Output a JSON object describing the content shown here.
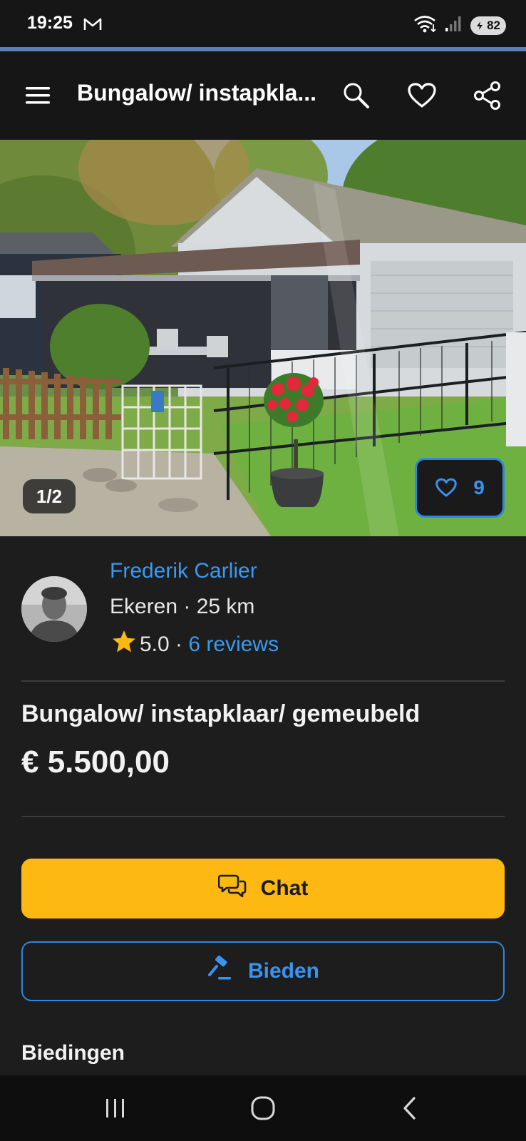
{
  "status_bar": {
    "time": "19:25",
    "battery": "82"
  },
  "app_bar": {
    "title": "Bungalow/ instapkla..."
  },
  "photo": {
    "counter": "1/2",
    "favorites_count": "9"
  },
  "seller": {
    "name": "Frederik Carlier",
    "location": "Ekeren · 25 km",
    "rating": "5.0",
    "separator": " · ",
    "reviews": "6 reviews"
  },
  "listing": {
    "title": "Bungalow/ instapklaar/ gemeubeld",
    "price": "€ 5.500,00"
  },
  "actions": {
    "chat_label": "Chat",
    "bid_label": "Bieden"
  },
  "sections": {
    "bids_title": "Biedingen"
  },
  "colors": {
    "accent_blue": "#3a9af0",
    "chat_yellow": "#fdb812",
    "star": "#fdb812",
    "background": "#1d1d1d"
  },
  "icons": [
    "mail-icon",
    "wifi-icon",
    "signal-icon",
    "battery-icon",
    "menu-icon",
    "search-icon",
    "heart-icon",
    "share-icon",
    "star-icon",
    "chat-icon",
    "gavel-icon",
    "nav-recents-icon",
    "nav-home-icon",
    "nav-back-icon"
  ]
}
